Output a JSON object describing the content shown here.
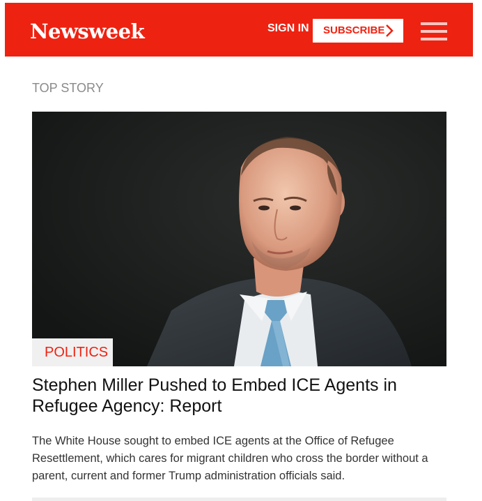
{
  "header": {
    "logo": "Newsweek",
    "sign_in_label": "SIGN IN",
    "subscribe_label": "SUBSCRIBE",
    "menu_icon": "hamburger-menu-icon",
    "chevron_icon": "chevron-right-icon",
    "brand_color": "#ee2211"
  },
  "section": {
    "label": "TOP STORY"
  },
  "story": {
    "category": "POLITICS",
    "headline": "Stephen Miller Pushed to Embed ICE Agents in Refugee Agency: Report",
    "summary": "The White House sought to embed ICE agents at the Office of Refugee Resettlement, which cares for migrant children who cross the border without a parent, current and former Trump administration officials said."
  }
}
